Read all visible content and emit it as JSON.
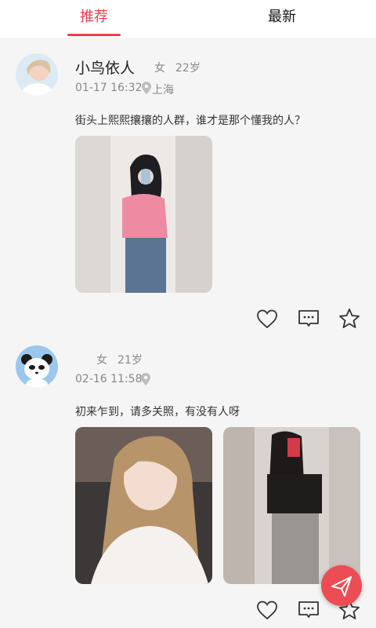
{
  "tabs": [
    {
      "label": "推荐"
    },
    {
      "label": "最新"
    }
  ],
  "posts": [
    {
      "name": "小鸟依人",
      "gender": "女",
      "age": "22岁",
      "time": "01-17 16:32",
      "location": "上海",
      "text": "街头上熙熙攘攘的人群，谁才是那个懂我的人？"
    },
    {
      "name": "",
      "gender": "女",
      "age": "21岁",
      "time": "02-16 11:58",
      "location": "",
      "text": "初来乍到，请多关照，有没有人呀"
    }
  ],
  "icons": {
    "like": "heart-icon",
    "comment": "comment-icon",
    "favorite": "star-icon",
    "location": "location-pin-icon",
    "send": "paper-plane-icon"
  },
  "colors": {
    "accent": "#e8414a"
  }
}
